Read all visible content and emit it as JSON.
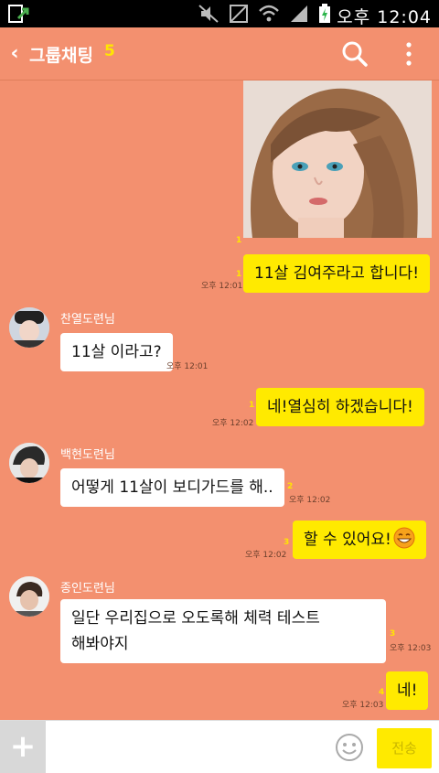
{
  "status": {
    "meridiem": "오후",
    "time": "12:04"
  },
  "header": {
    "title": "그룹채팅",
    "member_count": "5"
  },
  "messages": {
    "m1": {
      "unread": "1"
    },
    "m2": {
      "unread": "1",
      "text": "11살 김여주라고 합니다!",
      "time": "오후 12:01"
    },
    "m3": {
      "sender": "찬열도련님",
      "text": "11살 이라고?",
      "time": "오후 12:01"
    },
    "m4": {
      "unread": "1",
      "text": "네!열심히 하겠습니다!",
      "time": "오후 12:02"
    },
    "m5": {
      "sender": "백현도련님",
      "text": "어떻게 11살이 보디가드를 해..",
      "unread": "2",
      "time": "오후 12:02"
    },
    "m6": {
      "unread": "3",
      "text": "할 수 있어요!",
      "time": "오후 12:02"
    },
    "m7": {
      "sender": "종인도련님",
      "line1": "일단 우리집으로 오도록해 체력 테스트",
      "line2": "해봐야지",
      "unread": "3",
      "time": "오후 12:03"
    },
    "m8": {
      "unread": "4",
      "text": "네!",
      "time": "오후 12:03"
    }
  },
  "composer": {
    "send_label": "전송",
    "input_value": ""
  }
}
